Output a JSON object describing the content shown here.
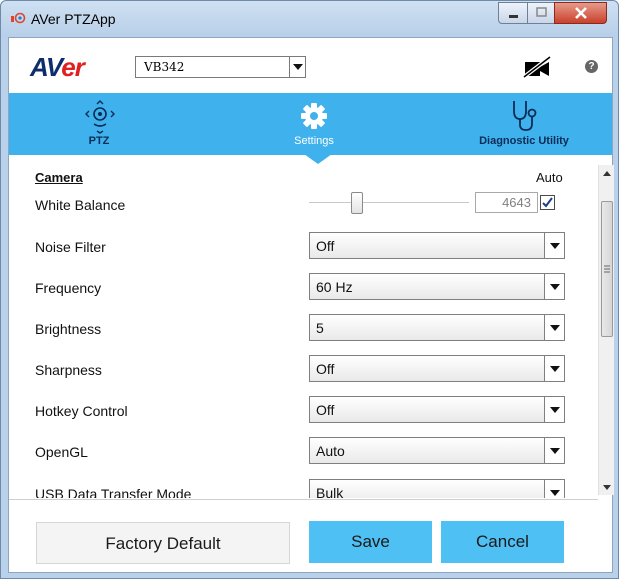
{
  "window": {
    "title": "AVer PTZApp"
  },
  "header": {
    "logo_main": "AV",
    "logo_accent": "er",
    "device": "VB342",
    "camera_icon": "camera-off-icon",
    "help_icon": "help-icon",
    "help_glyph": "?"
  },
  "tabs": [
    {
      "label": "PTZ",
      "icon": "ptz-icon"
    },
    {
      "label": "Settings",
      "icon": "gear-icon"
    },
    {
      "label": "Diagnostic Utility",
      "icon": "stethoscope-icon"
    }
  ],
  "camera": {
    "section_title": "Camera",
    "auto_label": "Auto",
    "white_balance": {
      "label": "White Balance",
      "value": "4643",
      "auto_checked": true,
      "slider_fraction": 0.3
    },
    "settings": [
      {
        "label": "Noise Filter",
        "value": "Off"
      },
      {
        "label": "Frequency",
        "value": "60 Hz"
      },
      {
        "label": "Brightness",
        "value": "5"
      },
      {
        "label": "Sharpness",
        "value": "Off"
      },
      {
        "label": "Hotkey Control",
        "value": "Off"
      },
      {
        "label": "OpenGL",
        "value": "Auto"
      },
      {
        "label": "USB Data Transfer Mode",
        "value": "Bulk"
      }
    ]
  },
  "footer": {
    "factory_default": "Factory Default",
    "save": "Save",
    "cancel": "Cancel"
  },
  "colors": {
    "accent": "#3fb2ee",
    "button": "#4fc0f3",
    "logo": "#0d2d6b"
  }
}
